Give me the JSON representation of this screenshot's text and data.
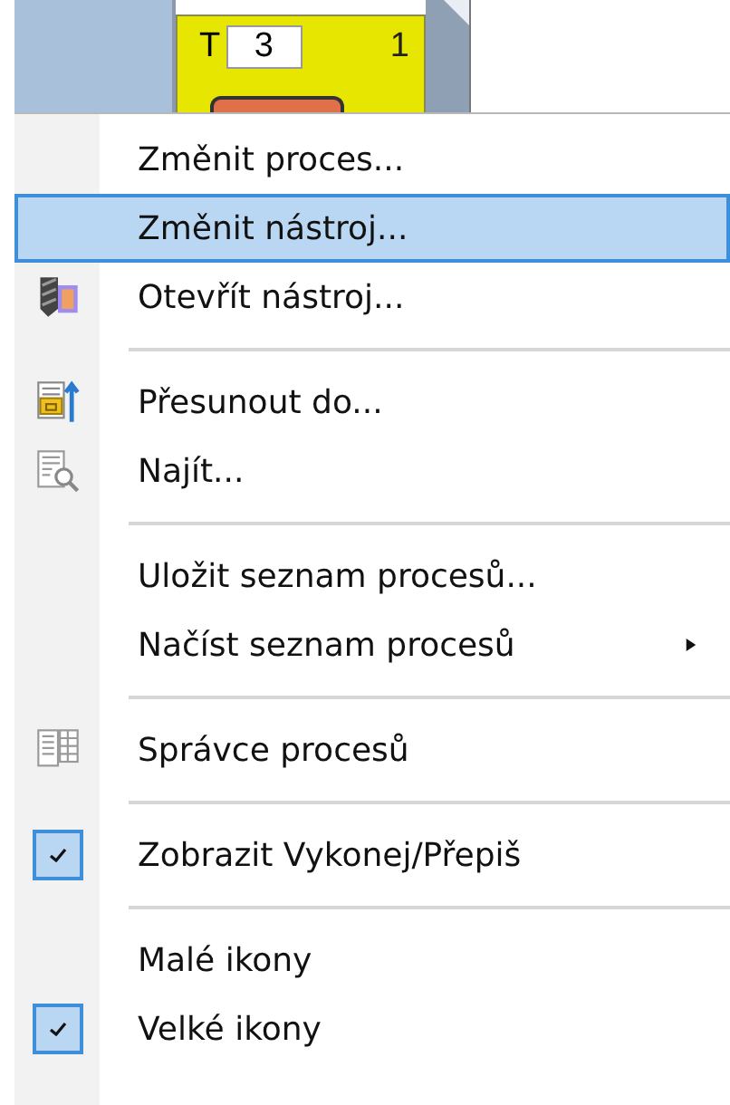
{
  "background_card": {
    "label": "T",
    "value": "3",
    "number": "1"
  },
  "menu": {
    "items": [
      {
        "kind": "plain",
        "label": "Změnit proces...",
        "selected": false,
        "checked": false
      },
      {
        "kind": "plain",
        "label": "Změnit nástroj...",
        "selected": true,
        "checked": false
      },
      {
        "kind": "tool",
        "label": "Otevřít nástroj...",
        "selected": false,
        "checked": false
      },
      {
        "kind": "separator"
      },
      {
        "kind": "move",
        "label": "Přesunout do...",
        "selected": false,
        "checked": false
      },
      {
        "kind": "find",
        "label": "Najít...",
        "selected": false,
        "checked": false
      },
      {
        "kind": "separator"
      },
      {
        "kind": "plain",
        "label": "Uložit seznam procesů...",
        "selected": false,
        "checked": false
      },
      {
        "kind": "submenu",
        "label": "Načíst seznam procesů",
        "selected": false,
        "checked": false
      },
      {
        "kind": "separator"
      },
      {
        "kind": "manager",
        "label": "Správce procesů",
        "selected": false,
        "checked": false
      },
      {
        "kind": "separator"
      },
      {
        "kind": "plain",
        "label": "Zobrazit Vykonej/Přepiš",
        "selected": false,
        "checked": true
      },
      {
        "kind": "separator"
      },
      {
        "kind": "plain",
        "label": "Malé ikony",
        "selected": false,
        "checked": false
      },
      {
        "kind": "plain",
        "label": "Velké ikony",
        "selected": false,
        "checked": true
      }
    ]
  }
}
